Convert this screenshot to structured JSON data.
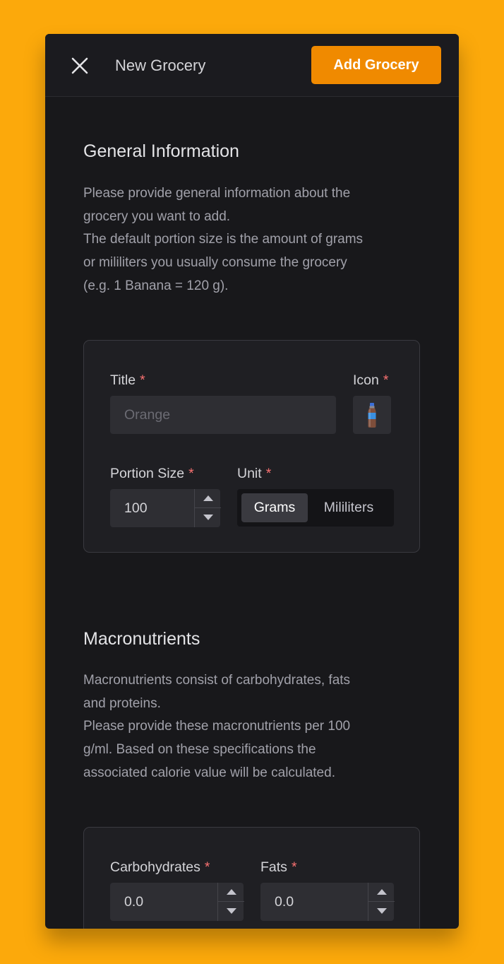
{
  "header": {
    "title": "New Grocery",
    "add_button_label": "Add Grocery"
  },
  "general": {
    "title": "General Information",
    "description_lines": [
      "Please provide general information about the",
      "grocery you want to add.",
      "The default portion size is the amount of grams",
      "or mililiters you usually consume the grocery",
      "(e.g. 1 Banana = 120 g)."
    ],
    "title_field": {
      "label": "Title",
      "required_mark": "*",
      "placeholder": "Orange",
      "value": ""
    },
    "icon_field": {
      "label": "Icon",
      "required_mark": "*",
      "icon": "water-bottle-icon"
    },
    "portion_field": {
      "label": "Portion Size",
      "required_mark": "*",
      "value": "100"
    },
    "unit_field": {
      "label": "Unit",
      "required_mark": "*",
      "options": [
        "Grams",
        "Mililiters"
      ],
      "selected": "Grams"
    }
  },
  "macros": {
    "title": "Macronutrients",
    "description_lines": [
      "Macronutrients consist of carbohydrates, fats",
      "and proteins.",
      "Please provide these macronutrients per 100",
      "g/ml. Based on these specifications the",
      "associated calorie value will be calculated."
    ],
    "carbs_field": {
      "label": "Carbohydrates",
      "required_mark": "*",
      "value": "0.0"
    },
    "fats_field": {
      "label": "Fats",
      "required_mark": "*",
      "value": "0.0"
    }
  },
  "colors": {
    "background": "#FCA90B",
    "panel": "#18181B",
    "accent": "#F08A00",
    "required": "#F87171"
  }
}
